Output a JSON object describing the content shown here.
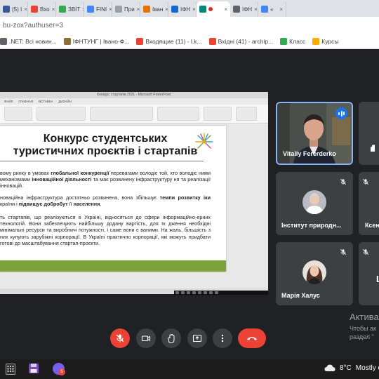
{
  "browser": {
    "tabs": [
      {
        "label": "(5) I",
        "color": "#3a5998"
      },
      {
        "label": "Вхо",
        "color": "#ea4335"
      },
      {
        "label": "ЗВІТ",
        "color": "#34a853"
      },
      {
        "label": "FINI",
        "color": "#4285f4"
      },
      {
        "label": "При",
        "color": "#9aa0a6"
      },
      {
        "label": "Іван",
        "color": "#e37400"
      },
      {
        "label": "ІФН",
        "color": "#1967d2"
      },
      {
        "label": "",
        "color": "#00897b",
        "active": true
      },
      {
        "label": "ІФН",
        "color": "#5f6368"
      },
      {
        "label": "«",
        "color": "#4285f4"
      }
    ],
    "url": "bu-zox?authuser=3",
    "bookmarks": [
      {
        "label": ".NET: Всі новин...",
        "color": "#5f6368"
      },
      {
        "label": "ІФНТУНГ | Івано-Ф...",
        "color": "#8a6d3b"
      },
      {
        "label": "Входящие (11) - l.k...",
        "color": "#ea4335"
      },
      {
        "label": "Вхідні (41) - archip...",
        "color": "#ea4335"
      },
      {
        "label": "Класс",
        "color": "#34a853"
      },
      {
        "label": "Курсы",
        "color": "#f9ab00"
      }
    ]
  },
  "ppt": {
    "window_title": "Конкурс стартапів 2021 - Microsoft PowerPoint",
    "menu": [
      "ФАЙЛ",
      "ГЛАВНАЯ",
      "ВСТАВКА",
      "ДИЗАЙН"
    ]
  },
  "slide": {
    "title_line1": "Конкурс студентських",
    "title_line2": "туристичних проєктів і стартапів",
    "p1": [
      {
        "t": "вому ринку в умовах ",
        "b": false
      },
      {
        "t": "глобальної конкуренції",
        "b": true
      },
      {
        "t": " перевагами володіє той, хто володіє ",
        "b": false
      },
      {
        "t": "ними механізмами ",
        "b": false
      },
      {
        "t": "інноваційної діяльності",
        "b": true
      },
      {
        "t": " та має розвинену інфраструктуру ",
        "b": false
      },
      {
        "t": "ня та реалізації інновацій.",
        "b": false
      }
    ],
    "p2": [
      {
        "t": "новаційна інфраструктура достатньо розвинена, вона збільшує ",
        "b": false
      },
      {
        "t": "темпи розвитку ",
        "b": true
      },
      {
        "t": "іки",
        "b": true
      },
      {
        "t": " країни і ",
        "b": false
      },
      {
        "t": "підвищує добробут",
        "b": true
      },
      {
        "t": " її ",
        "b": false
      },
      {
        "t": "населення",
        "b": true
      },
      {
        "t": ".",
        "b": false
      }
    ],
    "p3": "ть стартапів, що реалізуються в Україні, відносяться до сфери інформаційно-ерних технологій. Вони забезпечують найбільшу додану вартість, для їх дження необхідні мінімальні ресурси та виробничі потужності, і саме вони є ваними. На жаль, більшість з них купують зарубіжні корпорації. В Україні практично корпорації, які можуть придбати готові до масштабування стартап-проєкти."
  },
  "participants": [
    {
      "name": "Vitaliy Fererderko",
      "speaking": true
    },
    {
      "name": "",
      "raised_hand": true
    },
    {
      "name": "Інститут природн...",
      "muted": true
    },
    {
      "name": "Ксен",
      "muted": true
    },
    {
      "name": "Марія Халус",
      "muted": true
    },
    {
      "name": "L",
      "muted": false
    }
  ],
  "controls": {
    "mic": "mic-off",
    "camera": "camera",
    "hand": "raise-hand",
    "present": "present-now",
    "more": "more-options",
    "end": "end-call",
    "danger_color": "#ea4335"
  },
  "watermark": {
    "title": "Актива",
    "line1": "Чтобы ак",
    "line2": "раздел \""
  },
  "taskbar": {
    "temperature": "8°C",
    "weather": "Mostly c"
  }
}
